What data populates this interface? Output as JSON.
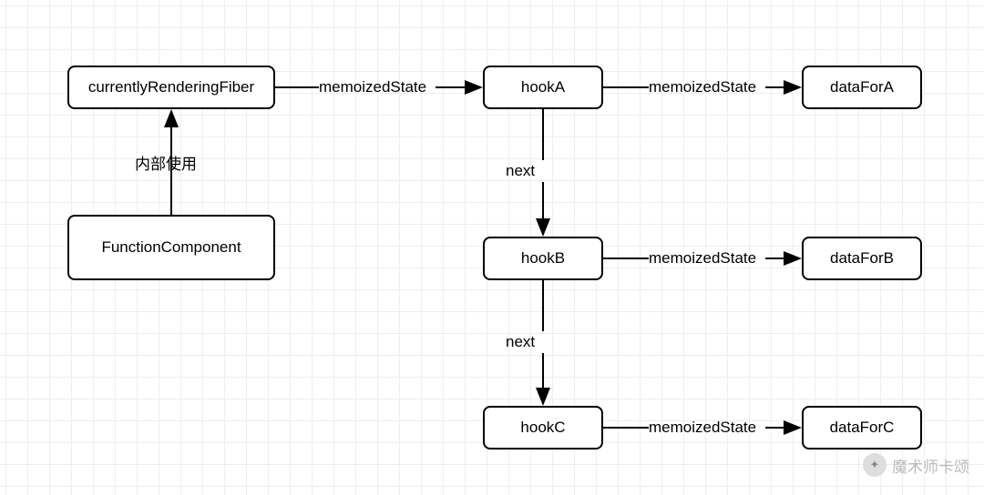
{
  "nodes": {
    "currentlyRenderingFiber": {
      "label": "currentlyRenderingFiber"
    },
    "functionComponent": {
      "label": "FunctionComponent"
    },
    "hookA": {
      "label": "hookA"
    },
    "hookB": {
      "label": "hookB"
    },
    "hookC": {
      "label": "hookC"
    },
    "dataForA": {
      "label": "dataForA"
    },
    "dataForB": {
      "label": "dataForB"
    },
    "dataForC": {
      "label": "dataForC"
    }
  },
  "edges": {
    "fcToCrf": {
      "label": "内部使用"
    },
    "crfToHookA": {
      "label": "memoizedState"
    },
    "hookAToDataA": {
      "label": "memoizedState"
    },
    "hookBToDataB": {
      "label": "memoizedState"
    },
    "hookCToDataC": {
      "label": "memoizedState"
    },
    "hookAToHookB": {
      "label": "next"
    },
    "hookBToHookC": {
      "label": "next"
    }
  },
  "watermark": {
    "text": "魔术师卡颂",
    "iconHint": "wechat"
  }
}
